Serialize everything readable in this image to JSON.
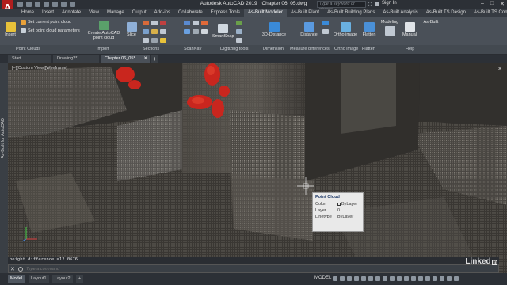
{
  "app": {
    "logo_letter": "A",
    "title_app": "Autodesk AutoCAD 2019",
    "title_file": "Chapter 06_05.dwg",
    "search_placeholder": "Type a keyword or phrase",
    "sign_in": "Sign In"
  },
  "ribbon_tabs": [
    "Home",
    "Insert",
    "Annotate",
    "View",
    "Manage",
    "Output",
    "Add-ins",
    "Collaborate",
    "Express Tools",
    "As-Built Modeler",
    "As-Built Plant",
    "As-Built Building Plans",
    "As-Built Analysis",
    "As-Built TS Design",
    "As-Built TS Control"
  ],
  "ribbon_active_tab": "As-Built Modeler",
  "ribbon": {
    "insert": "Insert",
    "set_current": "Set current point cloud",
    "set_params": "Set point cloud parameters",
    "create_1": "Create AutoCAD",
    "create_2": "point cloud",
    "slice": "Slice",
    "smartsnap": "SmartSnap",
    "distance3d": "3D-Distance",
    "distance": "Distance",
    "ortho": "Ortho image",
    "flatten": "Flatten",
    "modeling": "Modeling",
    "manual": "Manual",
    "asbuilt": "As-Built"
  },
  "ribbon_panels": [
    "Point Clouds",
    "Import",
    "Sections",
    "ScanNav",
    "Digitizing tools",
    "Dimension",
    "Measure differences",
    "Ortho image",
    "Flatten",
    "Help"
  ],
  "doc_tabs": [
    "Start",
    "Drawing2*",
    "Chapter 06_05*"
  ],
  "doc_active": "Chapter 06_05*",
  "viewport": {
    "label": "[−][Custom View][Wireframe]",
    "side_palette": "As-Built for AutoCAD"
  },
  "quick_props": {
    "title": "Point Cloud",
    "rows": [
      {
        "key": "Color",
        "value": "ByLayer"
      },
      {
        "key": "Layer",
        "value": "0"
      },
      {
        "key": "Linetype",
        "value": "ByLayer"
      }
    ]
  },
  "command": {
    "history": "height difference =12.0676",
    "placeholder": "Type a command"
  },
  "layout_tabs": [
    "Model",
    "Layout1",
    "Layout2"
  ],
  "layout_active": "Model",
  "status_model": "MODEL",
  "watermark": "Linked",
  "watermark_suffix": "in"
}
